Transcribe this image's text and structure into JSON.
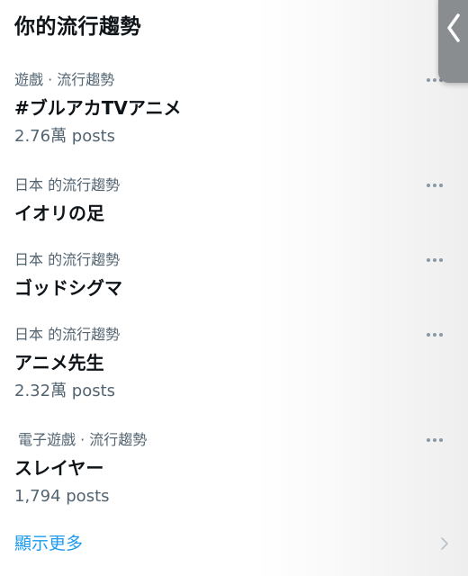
{
  "header": {
    "title": "你的流行趨勢"
  },
  "trends": [
    {
      "context": "遊戲 · 流行趨勢",
      "title": "#ブルアカTVアニメ",
      "count": "2.76萬 posts"
    },
    {
      "context": "日本 的流行趨勢",
      "title": "イオリの足",
      "count": ""
    },
    {
      "context": "日本 的流行趨勢",
      "title": "ゴッドシグマ",
      "count": ""
    },
    {
      "context": "日本 的流行趨勢",
      "title": "アニメ先生",
      "count": "2.32萬 posts"
    },
    {
      "context": "電子遊戲 · 流行趨勢",
      "title": "スレイヤー",
      "count": "1,794 posts"
    }
  ],
  "footer": {
    "show_more_label": "顯示更多"
  },
  "icons": {
    "more": "more-horizontal-icon",
    "show_more": "chevron-right-icon",
    "side_tab": "chevron-left-icon"
  },
  "colors": {
    "text_primary": "#0f1419",
    "text_secondary": "#536471",
    "link": "#1d9bf0",
    "side_tab": "#8a8d90"
  }
}
